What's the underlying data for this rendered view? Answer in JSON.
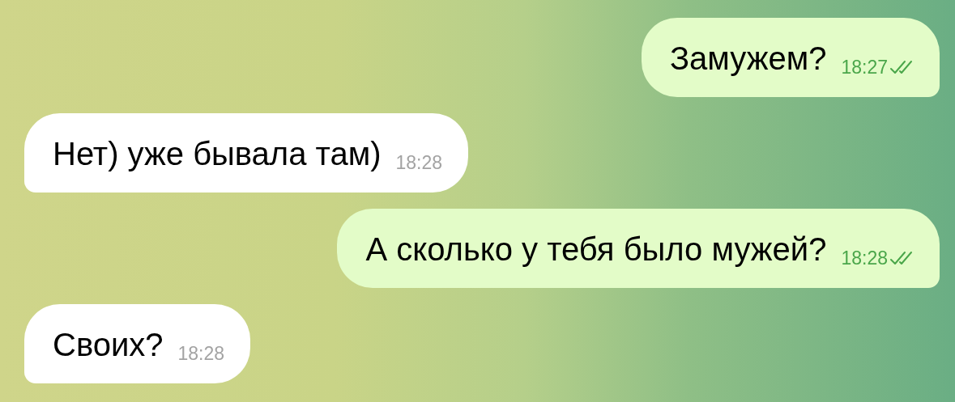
{
  "messages": [
    {
      "kind": "outgoing",
      "text": "Замужем?",
      "time": "18:27",
      "read": true
    },
    {
      "kind": "incoming",
      "text": "Нет) уже бывала там)",
      "time": "18:28"
    },
    {
      "kind": "outgoing",
      "text": "А сколько у тебя было мужей?",
      "time": "18:28",
      "read": true
    },
    {
      "kind": "incoming",
      "text": "Своих?",
      "time": "18:28"
    }
  ]
}
